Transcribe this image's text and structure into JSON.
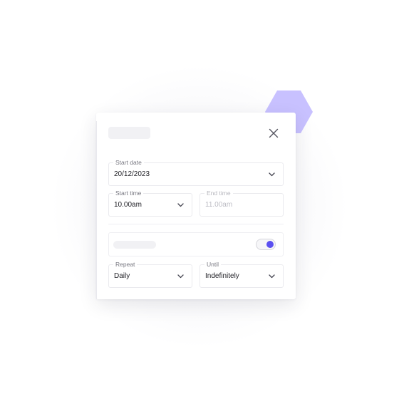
{
  "colors": {
    "accent": "#5b50f0",
    "hexagon": "#c8c1ff",
    "border": "#eaeaee",
    "text": "#222228",
    "label": "#777780",
    "muted": "#bcbcc4"
  },
  "icons": {
    "close": "close-icon",
    "chevron": "chevron-down-icon",
    "decoration": "hexagon-shape"
  },
  "form": {
    "start_date": {
      "label": "Start date",
      "value": "20/12/2023"
    },
    "start_time": {
      "label": "Start time",
      "value": "10.00am"
    },
    "end_time": {
      "label": "End time",
      "value": "11.00am"
    },
    "recurrence_toggle": {
      "on": true
    },
    "repeat": {
      "label": "Repeat",
      "value": "Daily"
    },
    "until": {
      "label": "Until",
      "value": "Indefinitely"
    }
  }
}
